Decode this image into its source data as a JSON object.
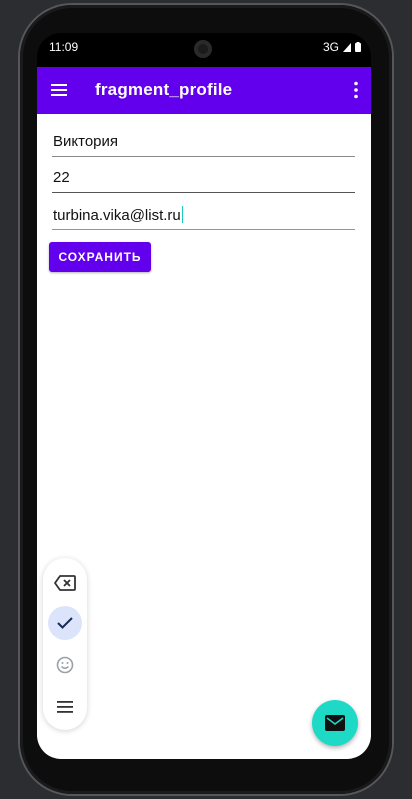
{
  "status": {
    "time": "11:09",
    "network": "3G"
  },
  "appbar": {
    "title": "fragment_profile"
  },
  "form": {
    "name_value": "Виктория",
    "age_value": "22",
    "email_value": "turbina.vika@list.ru",
    "save_label": "СОХРАНИТЬ"
  },
  "colors": {
    "primary": "#6200ee",
    "accent": "#1ed9c6"
  },
  "icons": {
    "menu": "hamburger-icon",
    "more": "more-vert-icon",
    "backspace": "backspace-icon",
    "check": "check-icon",
    "emoji": "emoji-icon",
    "list": "list-icon",
    "fab": "mail-icon"
  }
}
